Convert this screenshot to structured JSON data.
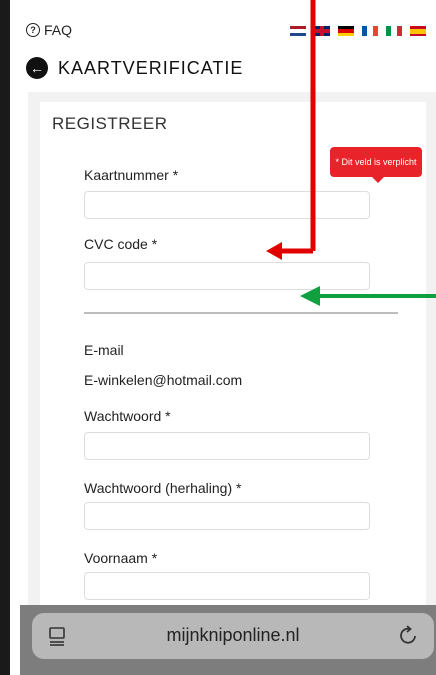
{
  "header": {
    "faq_label": "FAQ",
    "title": "KAARTVERIFICATIE"
  },
  "flags": [
    "nl-flag-icon",
    "gb-flag-icon",
    "de-flag-icon",
    "fr-flag-icon",
    "it-flag-icon",
    "es-flag-icon"
  ],
  "form": {
    "title": "REGISTREER",
    "card_number_label": "Kaartnummer *",
    "card_number_value": "",
    "error_tooltip": "* Dit veld is verplicht",
    "cvc_label": "CVC code *",
    "cvc_value": "",
    "email_label": "E-mail",
    "email_value": "E-winkelen@hotmail.com",
    "password_label": "Wachtwoord *",
    "password_repeat_label": "Wachtwoord (herhaling) *",
    "firstname_label": "Voornaam *"
  },
  "annotations": {
    "red_arrow_color": "#e00000",
    "green_arrow_color": "#10a040"
  },
  "browser": {
    "url": "mijnkniponline.nl"
  }
}
